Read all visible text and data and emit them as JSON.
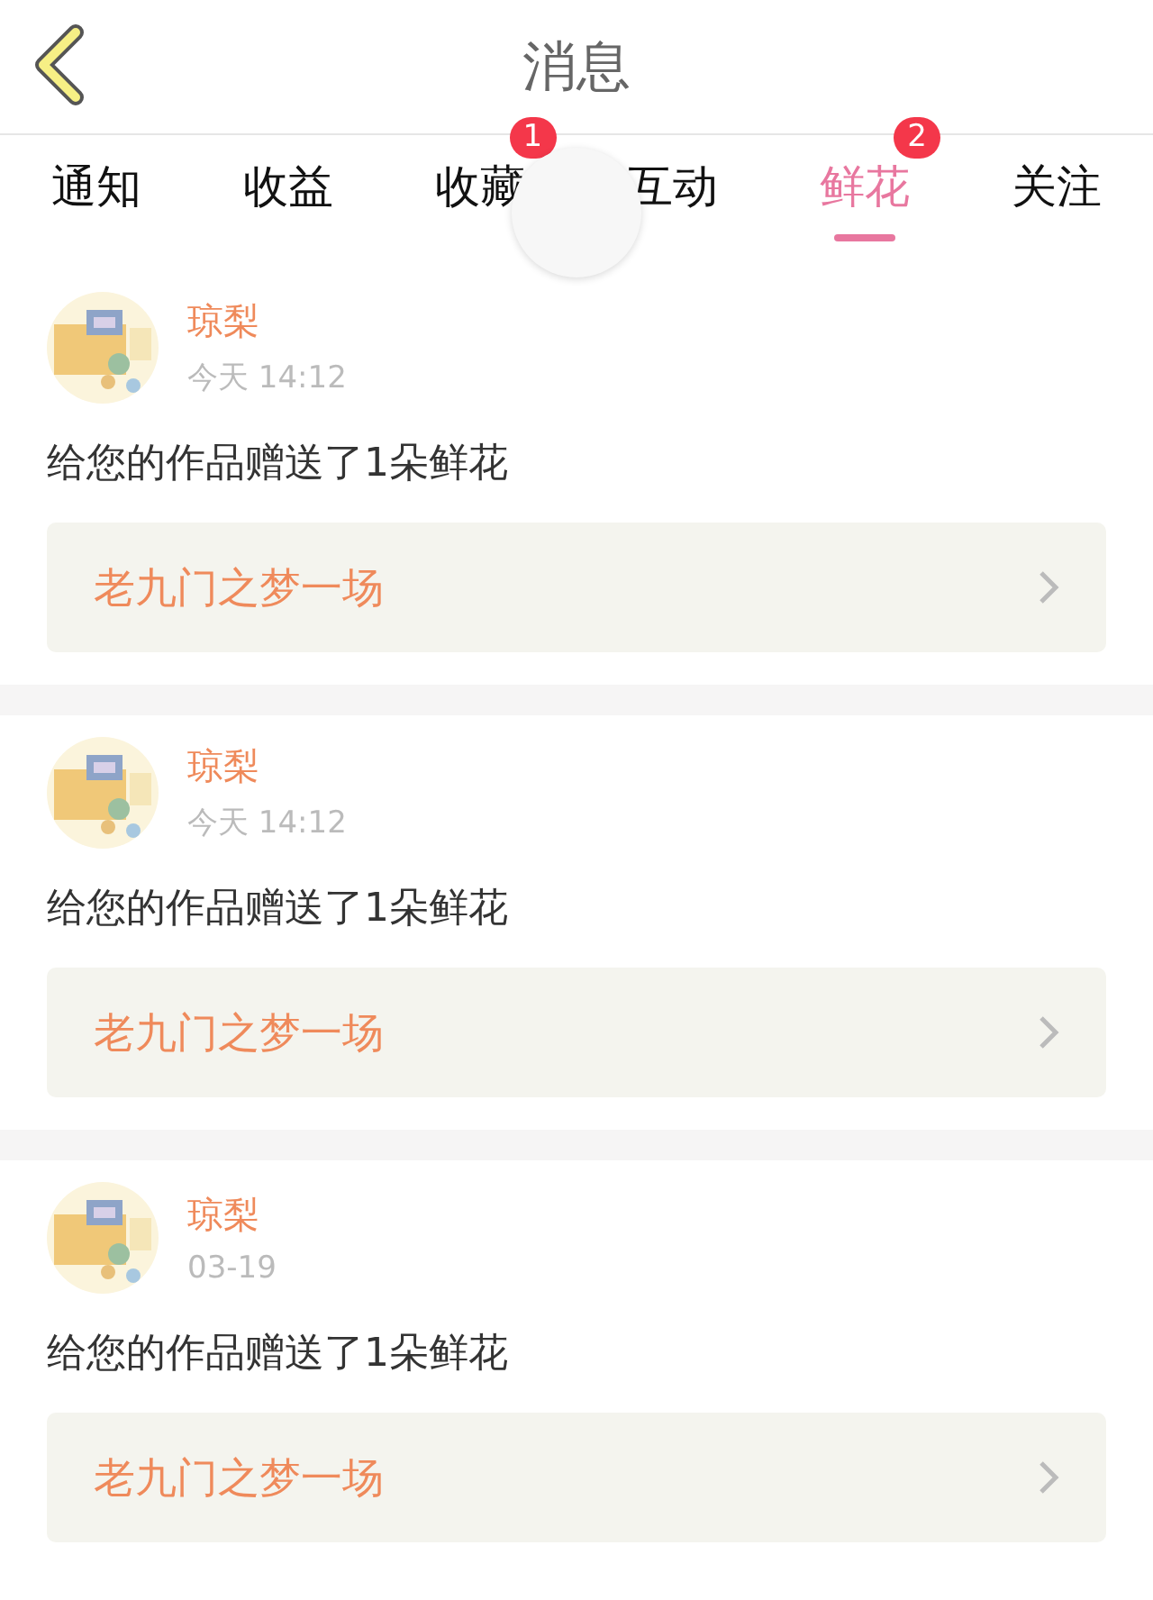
{
  "header": {
    "title": "消息"
  },
  "tabs": [
    {
      "label": "通知",
      "selected": false
    },
    {
      "label": "收益",
      "selected": false
    },
    {
      "label": "收藏",
      "selected": false,
      "badge": "1"
    },
    {
      "label": "互动",
      "selected": false
    },
    {
      "label": "鲜花",
      "selected": true,
      "badge": "2"
    },
    {
      "label": "关注",
      "selected": false
    }
  ],
  "messages": [
    {
      "user": "琼梨",
      "time": "今天 14:12",
      "text": "给您的作品赠送了1朵鲜花",
      "work": "老九门之梦一场"
    },
    {
      "user": "琼梨",
      "time": "今天 14:12",
      "text": "给您的作品赠送了1朵鲜花",
      "work": "老九门之梦一场"
    },
    {
      "user": "琼梨",
      "time": "03-19",
      "text": "给您的作品赠送了1朵鲜花",
      "work": "老九门之梦一场"
    }
  ]
}
